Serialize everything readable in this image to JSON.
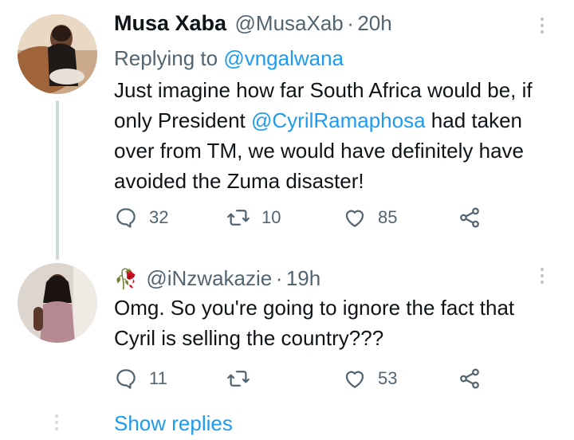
{
  "tweet1": {
    "author_name": "Musa Xaba",
    "author_handle": "@MusaXab",
    "separator": "·",
    "time": "20h",
    "replying_label": "Replying to",
    "replying_handle": "@vngalwana",
    "text_part1": "Just imagine how far South Africa would be, if only President ",
    "mention": "@CyrilRamaphosa",
    "text_part2": " had taken over from TM, we would have definitely have avoided the Zuma disaster!",
    "reply_count": "32",
    "retweet_count": "10",
    "like_count": "85"
  },
  "tweet2": {
    "author_emoji": "🥀",
    "author_handle": "@iNzwakazie",
    "separator": "·",
    "time": "19h",
    "text": "Omg. So you're going to ignore the fact that Cyril is selling the country???",
    "reply_count": "11",
    "retweet_count": "",
    "like_count": "53"
  },
  "show_replies_label": "Show replies",
  "colors": {
    "link": "#1d9bf0",
    "muted": "#536471",
    "thread_line": "#cfd9de"
  },
  "icons": [
    "reply-icon",
    "retweet-icon",
    "like-icon",
    "share-icon",
    "more-icon"
  ]
}
